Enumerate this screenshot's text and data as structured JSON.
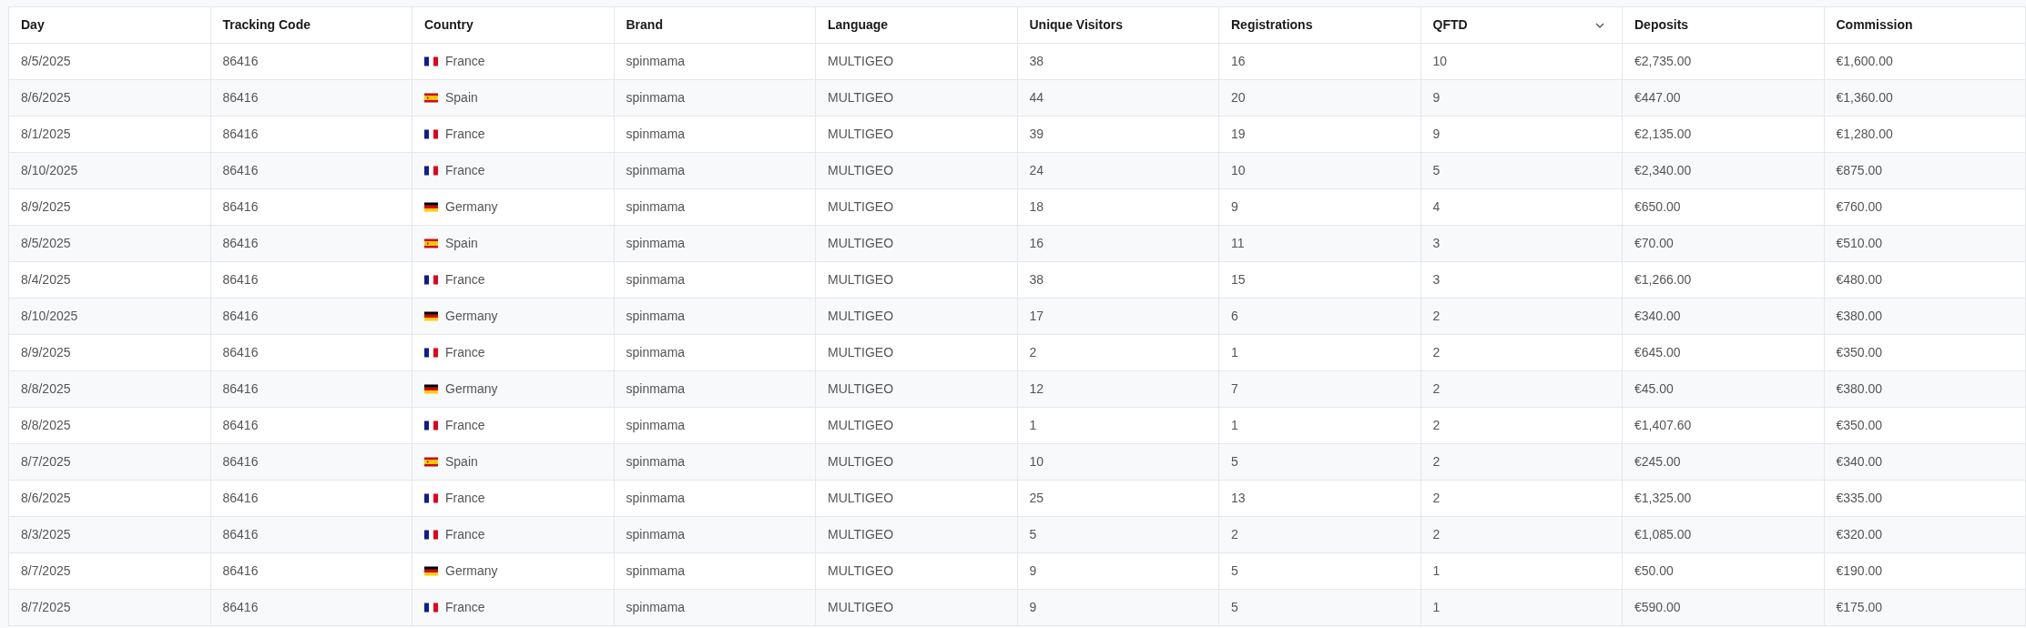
{
  "table": {
    "columns": [
      {
        "label": "Day",
        "sorted": false
      },
      {
        "label": "Tracking Code",
        "sorted": false
      },
      {
        "label": "Country",
        "sorted": false
      },
      {
        "label": "Brand",
        "sorted": false
      },
      {
        "label": "Language",
        "sorted": false
      },
      {
        "label": "Unique Visitors",
        "sorted": false
      },
      {
        "label": "Registrations",
        "sorted": false
      },
      {
        "label": "QFTD",
        "sorted": true
      },
      {
        "label": "Deposits",
        "sorted": false
      },
      {
        "label": "Commission",
        "sorted": false
      }
    ],
    "rows": [
      {
        "day": "8/5/2025",
        "code": "86416",
        "kind": "fr",
        "country": "France",
        "brand": "spinmama",
        "language": "MULTIGEO",
        "visitors": "38",
        "registrations": "16",
        "qftd": "10",
        "deposits": "€2,735.00",
        "commission": "€1,600.00"
      },
      {
        "day": "8/6/2025",
        "code": "86416",
        "kind": "es",
        "country": "Spain",
        "brand": "spinmama",
        "language": "MULTIGEO",
        "visitors": "44",
        "registrations": "20",
        "qftd": "9",
        "deposits": "€447.00",
        "commission": "€1,360.00"
      },
      {
        "day": "8/1/2025",
        "code": "86416",
        "kind": "fr",
        "country": "France",
        "brand": "spinmama",
        "language": "MULTIGEO",
        "visitors": "39",
        "registrations": "19",
        "qftd": "9",
        "deposits": "€2,135.00",
        "commission": "€1,280.00"
      },
      {
        "day": "8/10/2025",
        "code": "86416",
        "kind": "fr",
        "country": "France",
        "brand": "spinmama",
        "language": "MULTIGEO",
        "visitors": "24",
        "registrations": "10",
        "qftd": "5",
        "deposits": "€2,340.00",
        "commission": "€875.00"
      },
      {
        "day": "8/9/2025",
        "code": "86416",
        "kind": "de",
        "country": "Germany",
        "brand": "spinmama",
        "language": "MULTIGEO",
        "visitors": "18",
        "registrations": "9",
        "qftd": "4",
        "deposits": "€650.00",
        "commission": "€760.00"
      },
      {
        "day": "8/5/2025",
        "code": "86416",
        "kind": "es",
        "country": "Spain",
        "brand": "spinmama",
        "language": "MULTIGEO",
        "visitors": "16",
        "registrations": "11",
        "qftd": "3",
        "deposits": "€70.00",
        "commission": "€510.00"
      },
      {
        "day": "8/4/2025",
        "code": "86416",
        "kind": "fr",
        "country": "France",
        "brand": "spinmama",
        "language": "MULTIGEO",
        "visitors": "38",
        "registrations": "15",
        "qftd": "3",
        "deposits": "€1,266.00",
        "commission": "€480.00"
      },
      {
        "day": "8/10/2025",
        "code": "86416",
        "kind": "de",
        "country": "Germany",
        "brand": "spinmama",
        "language": "MULTIGEO",
        "visitors": "17",
        "registrations": "6",
        "qftd": "2",
        "deposits": "€340.00",
        "commission": "€380.00"
      },
      {
        "day": "8/9/2025",
        "code": "86416",
        "kind": "fr",
        "country": "France",
        "brand": "spinmama",
        "language": "MULTIGEO",
        "visitors": "2",
        "registrations": "1",
        "qftd": "2",
        "deposits": "€645.00",
        "commission": "€350.00"
      },
      {
        "day": "8/8/2025",
        "code": "86416",
        "kind": "de",
        "country": "Germany",
        "brand": "spinmama",
        "language": "MULTIGEO",
        "visitors": "12",
        "registrations": "7",
        "qftd": "2",
        "deposits": "€45.00",
        "commission": "€380.00"
      },
      {
        "day": "8/8/2025",
        "code": "86416",
        "kind": "fr",
        "country": "France",
        "brand": "spinmama",
        "language": "MULTIGEO",
        "visitors": "1",
        "registrations": "1",
        "qftd": "2",
        "deposits": "€1,407.60",
        "commission": "€350.00"
      },
      {
        "day": "8/7/2025",
        "code": "86416",
        "kind": "es",
        "country": "Spain",
        "brand": "spinmama",
        "language": "MULTIGEO",
        "visitors": "10",
        "registrations": "5",
        "qftd": "2",
        "deposits": "€245.00",
        "commission": "€340.00"
      },
      {
        "day": "8/6/2025",
        "code": "86416",
        "kind": "fr",
        "country": "France",
        "brand": "spinmama",
        "language": "MULTIGEO",
        "visitors": "25",
        "registrations": "13",
        "qftd": "2",
        "deposits": "€1,325.00",
        "commission": "€335.00"
      },
      {
        "day": "8/3/2025",
        "code": "86416",
        "kind": "fr",
        "country": "France",
        "brand": "spinmama",
        "language": "MULTIGEO",
        "visitors": "5",
        "registrations": "2",
        "qftd": "2",
        "deposits": "€1,085.00",
        "commission": "€320.00"
      },
      {
        "day": "8/7/2025",
        "code": "86416",
        "kind": "de",
        "country": "Germany",
        "brand": "spinmama",
        "language": "MULTIGEO",
        "visitors": "9",
        "registrations": "5",
        "qftd": "1",
        "deposits": "€50.00",
        "commission": "€190.00"
      },
      {
        "day": "8/7/2025",
        "code": "86416",
        "kind": "fr",
        "country": "France",
        "brand": "spinmama",
        "language": "MULTIGEO",
        "visitors": "9",
        "registrations": "5",
        "qftd": "1",
        "deposits": "€590.00",
        "commission": "€175.00"
      }
    ]
  }
}
